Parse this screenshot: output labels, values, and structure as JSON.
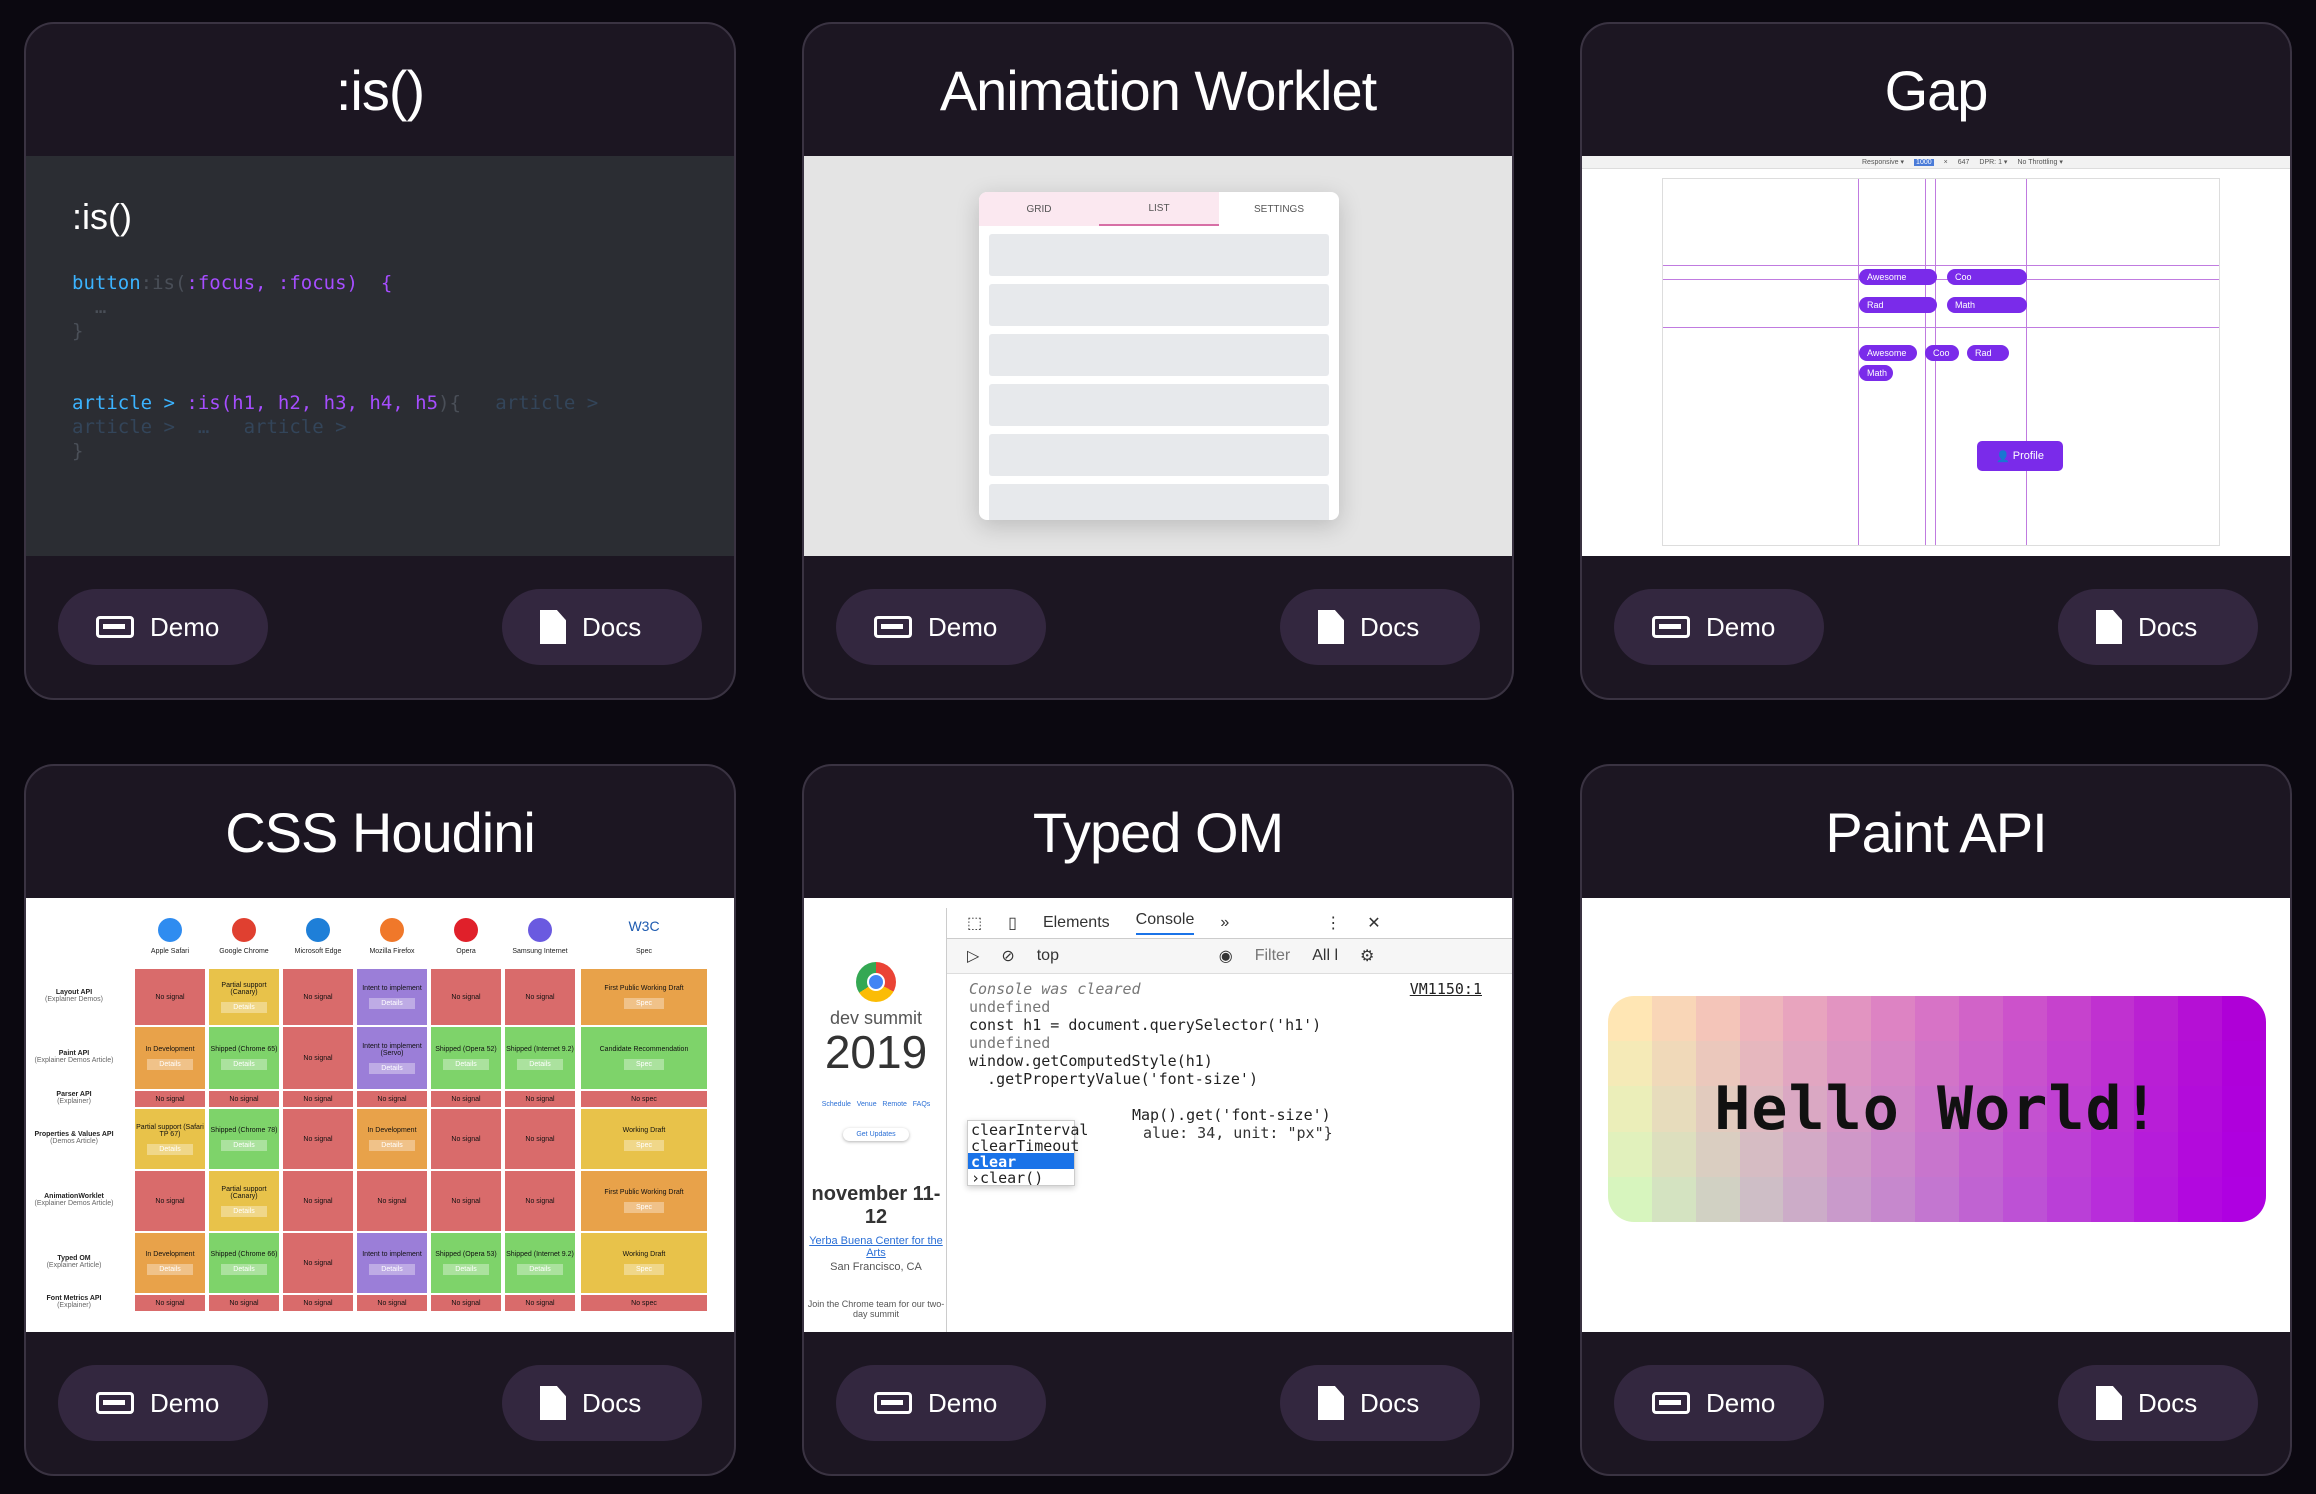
{
  "cards": [
    {
      "title": ":is()",
      "demo": "Demo",
      "docs": "Docs"
    },
    {
      "title": "Animation Worklet",
      "demo": "Demo",
      "docs": "Docs"
    },
    {
      "title": "Gap",
      "demo": "Demo",
      "docs": "Docs"
    },
    {
      "title": "CSS Houdini",
      "demo": "Demo",
      "docs": "Docs"
    },
    {
      "title": "Typed OM",
      "demo": "Demo",
      "docs": "Docs"
    },
    {
      "title": "Paint API",
      "demo": "Demo",
      "docs": "Docs"
    }
  ],
  "is_preview": {
    "heading": ":is()",
    "line1": "button",
    "line1b": ":is(",
    "line1c": ":focus, ",
    "line1d": ":focus)  {",
    "line2": "  …",
    "line3": "}",
    "line4": "article > ",
    "line4b": ":is(",
    "line4c": "h1, h2, h3, h4, h5",
    "line4d": "){",
    "line4e": "article >",
    "line5": "article >  …   article >",
    "line6": "}"
  },
  "aw_preview": {
    "tabs": [
      "GRID",
      "LIST",
      "SETTINGS"
    ]
  },
  "gap_preview": {
    "topbar": [
      "Responsive ▾",
      "1000",
      "×",
      "647",
      "DPR: 1 ▾",
      "No Throttling ▾"
    ],
    "pills_row1": [
      "Awesome",
      "Coo"
    ],
    "pills_row2": [
      "Rad",
      "Math"
    ],
    "pills_row3": [
      "Awesome",
      "Coo",
      "Rad"
    ],
    "pills_row4": [
      "Math"
    ],
    "profile": "Profile"
  },
  "houdini_preview": {
    "browsers": [
      "Apple Safari",
      "Google Chrome",
      "Microsoft Edge",
      "Mozilla Firefox",
      "Opera",
      "Samsung Internet",
      "Spec"
    ],
    "rows": [
      {
        "name": "Layout API",
        "sub": "(Explainer Demos)",
        "cells": [
          "No signal",
          "Partial support (Canary)",
          "No signal",
          "Intent to implement",
          "No signal",
          "No signal",
          "First Public Working Draft"
        ]
      },
      {
        "name": "Paint API",
        "sub": "(Explainer Demos Article)",
        "cells": [
          "In Development",
          "Shipped (Chrome 65)",
          "No signal",
          "Intent to implement (Servo)",
          "Shipped (Opera 52)",
          "Shipped (Internet 9.2)",
          "Candidate Recommendation"
        ]
      },
      {
        "name": "Parser API",
        "sub": "(Explainer)",
        "cells": [
          "No signal",
          "No signal",
          "No signal",
          "No signal",
          "No signal",
          "No signal",
          "No spec"
        ]
      },
      {
        "name": "Properties & Values API",
        "sub": "(Demos Article)",
        "cells": [
          "Partial support (Safari TP 67)",
          "Shipped (Chrome 78)",
          "No signal",
          "In Development",
          "No signal",
          "No signal",
          "Working Draft"
        ]
      },
      {
        "name": "AnimationWorklet",
        "sub": "(Explainer Demos Article)",
        "cells": [
          "No signal",
          "Partial support (Canary)",
          "No signal",
          "No signal",
          "No signal",
          "No signal",
          "First Public Working Draft"
        ]
      },
      {
        "name": "Typed OM",
        "sub": "(Explainer Article)",
        "cells": [
          "In Development",
          "Shipped (Chrome 66)",
          "No signal",
          "Intent to implement",
          "Shipped (Opera 53)",
          "Shipped (Internet 9.2)",
          "Working Draft"
        ]
      },
      {
        "name": "Font Metrics API",
        "sub": "(Explainer)",
        "cells": [
          "No signal",
          "No signal",
          "No signal",
          "No signal",
          "No signal",
          "No signal",
          "No spec"
        ]
      }
    ],
    "details": "Details",
    "spec": "Spec"
  },
  "typedom_preview": {
    "brand": "dev summit",
    "year": "2019",
    "links": "Schedule   Venue   Remote   FAQs",
    "updates": "Get Updates",
    "date": "november 11-12",
    "venue": "Yerba Buena Center for the Arts",
    "city": "San Francisco, CA",
    "blurb": "Join the Chrome team for our two-day summit",
    "tabs": [
      "Elements",
      "Console",
      "»"
    ],
    "context": "top",
    "filter": "Filter",
    "levels": "All l",
    "lines": [
      "Console was cleared",
      "undefined",
      "const h1 = document.querySelector('h1')",
      "undefined",
      "window.getComputedStyle(h1)",
      "  .getPropertyValue('font-size')",
      "",
      "",
      "Map().get('font-size')",
      "alue: 34, unit: \"px\"}",
      "clear",
      "ƒ"
    ],
    "vm": "VM1150:1",
    "autocomplete": [
      "clearInterval",
      "clearTimeout",
      "clear",
      "›clear()"
    ]
  },
  "paint_preview": {
    "text": "Hello World!"
  },
  "colors": {
    "page_bg": "#0b0810",
    "card_bg": "#1c1622",
    "button_bg": "#33273f",
    "accent_purple": "#7a2bea"
  }
}
